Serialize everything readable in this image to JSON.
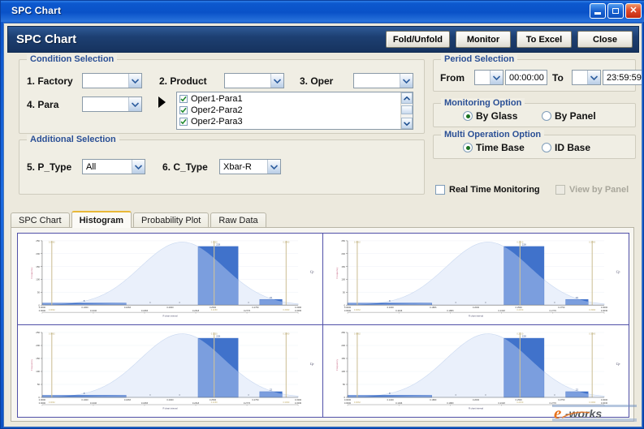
{
  "window": {
    "title": "SPC Chart",
    "buttons": {
      "minimize": "minimize-button",
      "restore": "restore-button",
      "close": "close-button"
    }
  },
  "header": {
    "title": "SPC Chart",
    "actions": [
      {
        "label": "Fold/Unfold"
      },
      {
        "label": "Monitor"
      },
      {
        "label": "To Excel"
      },
      {
        "label": "Close"
      }
    ]
  },
  "condition_selection": {
    "title": "Condition Selection",
    "fields": {
      "factory": {
        "label": "1. Factory",
        "value": ""
      },
      "product": {
        "label": "2. Product",
        "value": ""
      },
      "oper": {
        "label": "3. Oper",
        "value": ""
      },
      "para": {
        "label": "4. Para",
        "value": ""
      }
    },
    "param_list": [
      {
        "label": "Oper1-Para1",
        "checked": true
      },
      {
        "label": "Oper2-Para2",
        "checked": true
      },
      {
        "label": "Oper2-Para3",
        "checked": true
      }
    ]
  },
  "additional_selection": {
    "title": "Additional Selection",
    "p_type": {
      "label": "5. P_Type",
      "value": "All"
    },
    "c_type": {
      "label": "6. C_Type",
      "value": "Xbar-R"
    }
  },
  "period_selection": {
    "title": "Period Selection",
    "from_label": "From",
    "from_date": "",
    "from_time": "00:00:00",
    "to_label": "To",
    "to_date": "",
    "to_time": "23:59:59"
  },
  "monitoring_option": {
    "title": "Monitoring Option",
    "options": [
      {
        "label": "By Glass",
        "selected": true
      },
      {
        "label": "By Panel",
        "selected": false
      }
    ]
  },
  "multi_operation_option": {
    "title": "Multi Operation Option",
    "options": [
      {
        "label": "Time Base",
        "selected": true
      },
      {
        "label": "ID Base",
        "selected": false
      }
    ]
  },
  "checkboxes": {
    "real_time_monitoring": {
      "label": "Real Time Monitoring",
      "checked": false,
      "disabled": false
    },
    "view_by_panel": {
      "label": "View by Panel",
      "checked": false,
      "disabled": true
    }
  },
  "tabs": [
    {
      "label": "SPC Chart",
      "active": false
    },
    {
      "label": "Histogram",
      "active": true
    },
    {
      "label": "Probability Plot",
      "active": false
    },
    {
      "label": "Raw Data",
      "active": false
    }
  ],
  "watermark": {
    "text_e": "e",
    "text_works": "-works"
  },
  "colors": {
    "title_bar": "#0a52c8",
    "app_header": "#1d3f72",
    "form_bg": "#ece9dd",
    "group_bg": "#f0eee4",
    "group_title": "#2a4f95",
    "tab_active_accent": "#e8b838",
    "chart_border": "#5050a8",
    "bar_fill": "#7b9ede",
    "bar_fill_dark": "#3b6fc9",
    "curve_fill": "#eaf0fb",
    "spec_line": "#cfc29a",
    "axis_label": "#c86a86"
  },
  "chart_data": {
    "type": "bar",
    "title": "",
    "xlabel": "R chart interval",
    "ylabel": "Frequency",
    "count": 4,
    "note": "2x2 grid of four identical histograms with fitted normal curve overlay and spec-limit lines",
    "categories": [
      "0.0000",
      "0.1000",
      "0.1883",
      "0.2000",
      "0.2500",
      "0.2750",
      "0.3000"
    ],
    "xtick_labels": [
      "0.0000",
      "0.1000",
      "0.1883",
      "0.2000",
      "0.2500",
      "0.2750",
      "0.3000"
    ],
    "xtick_labels_lower": [
      "0.0000",
      "0.1046",
      "0.1883",
      "0.2318",
      "0.2770",
      "0.3030"
    ],
    "ytick_labels": [
      "0",
      "50",
      "100",
      "150",
      "200",
      "250"
    ],
    "ylim": [
      0,
      250
    ],
    "bars": [
      {
        "x0": 0.0,
        "x1": 0.105,
        "value": 8,
        "label": "8"
      },
      {
        "x0": 0.195,
        "x1": 0.245,
        "value": 228,
        "label": "228"
      },
      {
        "x0": 0.272,
        "x1": 0.3,
        "value": 22,
        "label": "22"
      }
    ],
    "zero_bins": [
      {
        "x": 0.135,
        "value": 0,
        "label": "0"
      },
      {
        "x": 0.172,
        "value": 0,
        "label": "0"
      },
      {
        "x": 0.258,
        "value": 0,
        "label": "0"
      }
    ],
    "curve": {
      "type": "normal",
      "mean": 0.175,
      "sigma": 0.052,
      "peak": 245
    },
    "spec_lines": [
      {
        "name": "LSL",
        "x": 0.012,
        "label": "0.0062"
      },
      {
        "name": "Target",
        "x": 0.215,
        "label": "0.2150"
      },
      {
        "name": "USL",
        "x": 0.305,
        "label": "0.3090"
      }
    ],
    "right_label": "Cp",
    "grid": true,
    "legend": "none"
  }
}
